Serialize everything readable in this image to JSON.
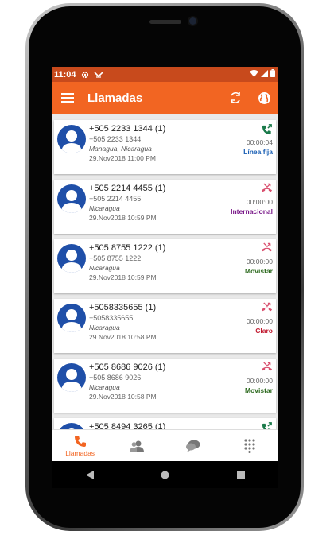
{
  "status_bar": {
    "time": "11:04",
    "icons": [
      "settings-icon",
      "signal-icon",
      "wifi-icon",
      "cellular-icon",
      "battery-icon"
    ]
  },
  "app_bar": {
    "title": "Llamadas",
    "actions": [
      "sync-icon",
      "globe-icon"
    ]
  },
  "calls": [
    {
      "name": "+505 2233 1344 (1)",
      "number": "+505 2233 1344",
      "location": "Managua, Nicaragua",
      "datetime": "29.Nov2018 11:00 PM",
      "duration": "00:00:04",
      "operator": "Línea fija",
      "operator_color": "#1a5fb4",
      "call_type": "answered",
      "icon_color": "#1a7a4a"
    },
    {
      "name": "+505 2214 4455 (1)",
      "number": "+505 2214 4455",
      "location": "Nicaragua",
      "datetime": "29.Nov2018 10:59 PM",
      "duration": "00:00:00",
      "operator": "Internacional",
      "operator_color": "#7a1a8a",
      "call_type": "missed",
      "icon_color": "#d94f6e"
    },
    {
      "name": "+505 8755 1222 (1)",
      "number": "+505 8755 1222",
      "location": "Nicaragua",
      "datetime": "29.Nov2018 10:59 PM",
      "duration": "00:00:00",
      "operator": "Movistar",
      "operator_color": "#2d6a1f",
      "call_type": "missed",
      "icon_color": "#d94f6e"
    },
    {
      "name": "+5058335655 (1)",
      "number": "+5058335655",
      "location": "Nicaragua",
      "datetime": "29.Nov2018 10:58 PM",
      "duration": "00:00:00",
      "operator": "Claro",
      "operator_color": "#c0182e",
      "call_type": "missed",
      "icon_color": "#d94f6e"
    },
    {
      "name": "+505 8686 9026 (1)",
      "number": "+505 8686 9026",
      "location": "Nicaragua",
      "datetime": "29.Nov2018 10:58 PM",
      "duration": "00:00:00",
      "operator": "Movistar",
      "operator_color": "#2d6a1f",
      "call_type": "missed",
      "icon_color": "#d94f6e"
    },
    {
      "name": "+505 8494 3265 (1)",
      "number": "",
      "location": "",
      "datetime": "",
      "duration": "",
      "operator": "",
      "operator_color": "#2d6a1f",
      "call_type": "answered",
      "icon_color": "#1a7a4a"
    }
  ],
  "bottom_nav": [
    {
      "icon": "phone-icon",
      "label": "Llamadas",
      "active": true
    },
    {
      "icon": "contacts-icon",
      "label": "",
      "active": false
    },
    {
      "icon": "chat-icon",
      "label": "",
      "active": false
    },
    {
      "icon": "dialpad-icon",
      "label": "",
      "active": false
    }
  ],
  "colors": {
    "accent": "#f26522",
    "status_bar": "#c84a1c",
    "avatar": "#1f4fa8"
  }
}
